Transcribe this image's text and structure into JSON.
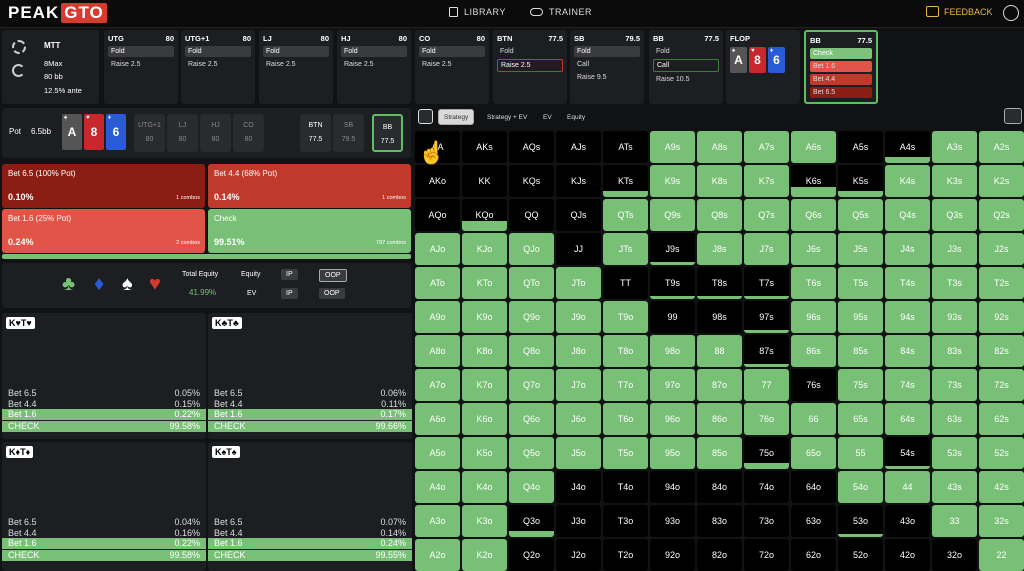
{
  "app": {
    "logo_a": "PEAK",
    "logo_b": "GTO",
    "library": "LIBRARY",
    "trainer": "TRAINER",
    "feedback": "FEEDBACK"
  },
  "settings": {
    "mode": "MTT",
    "table": "8Max",
    "stack": "80 bb",
    "ante": "12.5% ante"
  },
  "positions": [
    {
      "name": "UTG",
      "stack": "80",
      "actions": [
        "Fold",
        "Raise 2.5"
      ],
      "sel": 0
    },
    {
      "name": "UTG+1",
      "stack": "80",
      "actions": [
        "Fold",
        "Raise 2.5"
      ],
      "sel": 0
    },
    {
      "name": "LJ",
      "stack": "80",
      "actions": [
        "Fold",
        "Raise 2.5"
      ],
      "sel": 0
    },
    {
      "name": "HJ",
      "stack": "80",
      "actions": [
        "Fold",
        "Raise 2.5"
      ],
      "sel": 0
    },
    {
      "name": "CO",
      "stack": "80",
      "actions": [
        "Fold",
        "Raise 2.5"
      ],
      "sel": 0
    },
    {
      "name": "BTN",
      "stack": "77.5",
      "actions": [
        "Fold",
        "Raise 2.5"
      ],
      "sel": 1
    },
    {
      "name": "SB",
      "stack": "79.5",
      "actions": [
        "Fold",
        "Call",
        "Raise 9.5"
      ],
      "sel": 0
    },
    {
      "name": "BB",
      "stack": "77.5",
      "actions": [
        "Fold",
        "Call",
        "Raise 10.5"
      ],
      "sel": 1
    }
  ],
  "flop": {
    "label": "FLOP",
    "cards": [
      {
        "rank": "A",
        "suit": "♠",
        "color": "#555"
      },
      {
        "rank": "8",
        "suit": "♥",
        "color": "#c8272d"
      },
      {
        "rank": "6",
        "suit": "♦",
        "color": "#2a5bd7"
      }
    ]
  },
  "bb_panel": {
    "name": "BB",
    "stack": "77.5",
    "actions": [
      "Check",
      "Bet 1.6",
      "Bet 4.4",
      "Bet 6.5"
    ]
  },
  "pot": {
    "label": "Pot",
    "value": "6.5bb",
    "seats": [
      {
        "name": "UTG+1",
        "stack": "80"
      },
      {
        "name": "LJ",
        "stack": "80"
      },
      {
        "name": "HJ",
        "stack": "80"
      },
      {
        "name": "CO",
        "stack": "80"
      },
      {
        "name": "BTN",
        "stack": "77.5"
      },
      {
        "name": "SB",
        "stack": "79.5"
      },
      {
        "name": "BB",
        "stack": "77.5"
      }
    ],
    "hero_cards": [
      {
        "rank": "A",
        "suit": "♠",
        "color": "#555"
      },
      {
        "rank": "8",
        "suit": "♥",
        "color": "#c8272d"
      },
      {
        "rank": "6",
        "suit": "♦",
        "color": "#2a5bd7"
      }
    ]
  },
  "actions": [
    {
      "label": "Bet 6.5 (100% Pot)",
      "freq": "0.10%",
      "combos": "1 combos",
      "color": "#8c1d14"
    },
    {
      "label": "Bet 4.4 (68% Pot)",
      "freq": "0.14%",
      "combos": "1 combos",
      "color": "#c0392b"
    },
    {
      "label": "Bet 1.6 (25% Pot)",
      "freq": "0.24%",
      "combos": "2 combos",
      "color": "#e05548"
    },
    {
      "label": "Check",
      "freq": "99.51%",
      "combos": "797 combos",
      "color": "#78c076"
    }
  ],
  "equity": {
    "total_label": "Total Equity",
    "total_value": "41.99%",
    "equity_label": "Equity",
    "ev_label": "EV",
    "ip": "IP",
    "oop": "OOP"
  },
  "hands": [
    {
      "label": "K♥T♥",
      "rows": [
        [
          "Bet 6.5",
          "0.05%"
        ],
        [
          "Bet 4.4",
          "0.15%"
        ],
        [
          "Bet 1.6",
          "0.22%"
        ],
        [
          "CHECK",
          "99.58%"
        ]
      ]
    },
    {
      "label": "K♣T♣",
      "rows": [
        [
          "Bet 6.5",
          "0.06%"
        ],
        [
          "Bet 4.4",
          "0.11%"
        ],
        [
          "Bet 1.6",
          "0.17%"
        ],
        [
          "CHECK",
          "99.66%"
        ]
      ]
    },
    {
      "label": "K♦T♦",
      "rows": [
        [
          "Bet 6.5",
          "0.04%"
        ],
        [
          "Bet 4.4",
          "0.16%"
        ],
        [
          "Bet 1.6",
          "0.22%"
        ],
        [
          "CHECK",
          "99.58%"
        ]
      ]
    },
    {
      "label": "K♠T♠",
      "rows": [
        [
          "Bet 6.5",
          "0.07%"
        ],
        [
          "Bet 4.4",
          "0.14%"
        ],
        [
          "Bet 1.6",
          "0.24%"
        ],
        [
          "CHECK",
          "99.55%"
        ]
      ]
    }
  ],
  "tabs": [
    "Strategy",
    "Strategy + EV",
    "EV",
    "Equity"
  ],
  "grid": {
    "hands": [
      [
        "AA",
        "AKs",
        "AQs",
        "AJs",
        "ATs",
        "A9s",
        "A8s",
        "A7s",
        "A6s",
        "A5s",
        "A4s",
        "A3s",
        "A2s"
      ],
      [
        "AKo",
        "KK",
        "KQs",
        "KJs",
        "KTs",
        "K9s",
        "K8s",
        "K7s",
        "K6s",
        "K5s",
        "K4s",
        "K3s",
        "K2s"
      ],
      [
        "AQo",
        "KQo",
        "QQ",
        "QJs",
        "QTs",
        "Q9s",
        "Q8s",
        "Q7s",
        "Q6s",
        "Q5s",
        "Q4s",
        "Q3s",
        "Q2s"
      ],
      [
        "AJo",
        "KJo",
        "QJo",
        "JJ",
        "JTs",
        "J9s",
        "J8s",
        "J7s",
        "J6s",
        "J5s",
        "J4s",
        "J3s",
        "J2s"
      ],
      [
        "ATo",
        "KTo",
        "QTo",
        "JTo",
        "TT",
        "T9s",
        "T8s",
        "T7s",
        "T6s",
        "T5s",
        "T4s",
        "T3s",
        "T2s"
      ],
      [
        "A9o",
        "K9o",
        "Q9o",
        "J9o",
        "T9o",
        "99",
        "98s",
        "97s",
        "96s",
        "95s",
        "94s",
        "93s",
        "92s"
      ],
      [
        "A8o",
        "K8o",
        "Q8o",
        "J8o",
        "T8o",
        "98o",
        "88",
        "87s",
        "86s",
        "85s",
        "84s",
        "83s",
        "82s"
      ],
      [
        "A7o",
        "K7o",
        "Q7o",
        "J7o",
        "T7o",
        "97o",
        "87o",
        "77",
        "76s",
        "75s",
        "74s",
        "73s",
        "72s"
      ],
      [
        "A6o",
        "K6o",
        "Q6o",
        "J6o",
        "T6o",
        "96o",
        "86o",
        "76o",
        "66",
        "65s",
        "64s",
        "63s",
        "62s"
      ],
      [
        "A5o",
        "K5o",
        "Q5o",
        "J5o",
        "T5o",
        "95o",
        "85o",
        "75o",
        "65o",
        "55",
        "54s",
        "53s",
        "52s"
      ],
      [
        "A4o",
        "K4o",
        "Q4o",
        "J4o",
        "T4o",
        "94o",
        "84o",
        "74o",
        "64o",
        "54o",
        "44",
        "43s",
        "42s"
      ],
      [
        "A3o",
        "K3o",
        "Q3o",
        "J3o",
        "T3o",
        "93o",
        "83o",
        "73o",
        "63o",
        "53o",
        "43o",
        "33",
        "32s"
      ],
      [
        "A2o",
        "K2o",
        "Q2o",
        "J2o",
        "T2o",
        "92o",
        "82o",
        "72o",
        "62o",
        "52o",
        "42o",
        "32o",
        "22"
      ]
    ],
    "fill": [
      [
        0,
        0,
        0,
        0,
        0,
        1,
        1,
        1,
        1,
        0,
        0.2,
        1,
        1
      ],
      [
        0,
        0,
        0,
        0,
        0.2,
        1,
        1,
        1,
        0.3,
        0.2,
        1,
        1,
        1
      ],
      [
        0,
        0.3,
        0,
        0,
        1,
        1,
        1,
        1,
        1,
        1,
        1,
        1,
        1
      ],
      [
        1,
        1,
        1,
        0,
        1,
        0.1,
        1,
        1,
        1,
        1,
        1,
        1,
        1
      ],
      [
        1,
        1,
        1,
        1,
        0,
        0.1,
        0.1,
        0.1,
        1,
        1,
        1,
        1,
        1
      ],
      [
        1,
        1,
        1,
        1,
        1,
        0,
        0,
        0.1,
        1,
        1,
        1,
        1,
        1
      ],
      [
        1,
        1,
        1,
        1,
        1,
        1,
        1,
        0.1,
        1,
        1,
        1,
        1,
        1
      ],
      [
        1,
        1,
        1,
        1,
        1,
        1,
        1,
        1,
        0,
        1,
        1,
        1,
        1
      ],
      [
        1,
        1,
        1,
        1,
        1,
        1,
        1,
        1,
        1,
        1,
        1,
        1,
        1
      ],
      [
        1,
        1,
        1,
        1,
        1,
        1,
        1,
        0.2,
        1,
        1,
        0.1,
        1,
        1
      ],
      [
        1,
        1,
        1,
        0,
        0,
        0,
        0,
        0,
        0,
        1,
        1,
        1,
        1
      ],
      [
        1,
        1,
        0.2,
        0,
        0,
        0,
        0,
        0,
        0,
        0.1,
        0,
        1,
        1
      ],
      [
        1,
        1,
        0,
        0,
        0,
        0,
        0,
        0,
        0,
        0,
        0,
        0,
        1
      ]
    ]
  }
}
